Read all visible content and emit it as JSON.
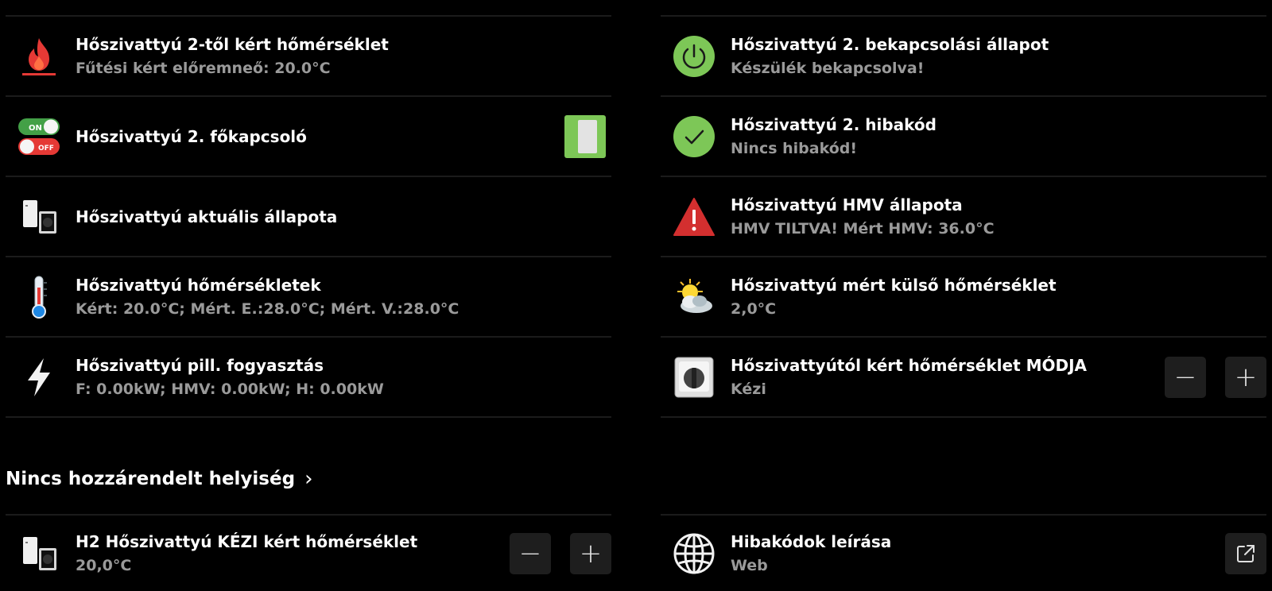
{
  "left_items": [
    {
      "title": "Hőszivattyú 2-től kért hőmérséklet",
      "subtitle": "Fűtési kért előremneő: 20.0°C",
      "icon": "flame-icon"
    },
    {
      "title": "Hőszivattyú 2. főkapcsoló",
      "subtitle": "",
      "icon": "on-off-switch-icon",
      "toggle_on": true
    },
    {
      "title": "Hőszivattyú aktuális állapota",
      "subtitle": "",
      "icon": "heat-pump-unit-icon"
    },
    {
      "title": "Hőszivattyú hőmérsékletek",
      "subtitle": "Kért: 20.0°C; Mért. E.:28.0°C; Mért. V.:28.0°C",
      "icon": "thermometer-icon"
    },
    {
      "title": "Hőszivattyú pill. fogyasztás",
      "subtitle": "F: 0.00kW; HMV: 0.00kW; H: 0.00kW",
      "icon": "lightning-icon"
    }
  ],
  "right_items": [
    {
      "title": "Hőszivattyú 2. bekapcsolási állapot",
      "subtitle": "Készülék bekapcsolva!",
      "icon": "power-icon"
    },
    {
      "title": "Hőszivattyú 2. hibakód",
      "subtitle": "Nincs hibakód!",
      "icon": "check-icon"
    },
    {
      "title": "Hőszivattyú HMV állapota",
      "subtitle": "HMV TILTVA! Mért HMV: 36.0°C",
      "icon": "warning-icon"
    },
    {
      "title": "Hőszivattyú mért külső hőmérséklet",
      "subtitle": "2,0°C",
      "icon": "weather-icon"
    },
    {
      "title": "Hőszivattyútól kért hőmérséklet MÓDJA",
      "subtitle": "Kézi",
      "icon": "rotary-switch-icon"
    }
  ],
  "section": {
    "title": "Nincs hozzárendelt helyiség",
    "chevron": "›"
  },
  "bottom_left": {
    "title": "H2 Hőszivattyú KÉZI kért hőmérséklet",
    "subtitle": "20,0°C",
    "icon": "heat-pump-unit-icon"
  },
  "bottom_right": {
    "title": "Hibakódok leírása",
    "subtitle": "Web",
    "icon": "globe-icon"
  },
  "controls": {
    "minus": "−",
    "plus": "+"
  },
  "colors": {
    "accent_green": "#7dc757",
    "warning_red": "#d32f2f",
    "subtitle_gray": "#9a9a9a"
  }
}
